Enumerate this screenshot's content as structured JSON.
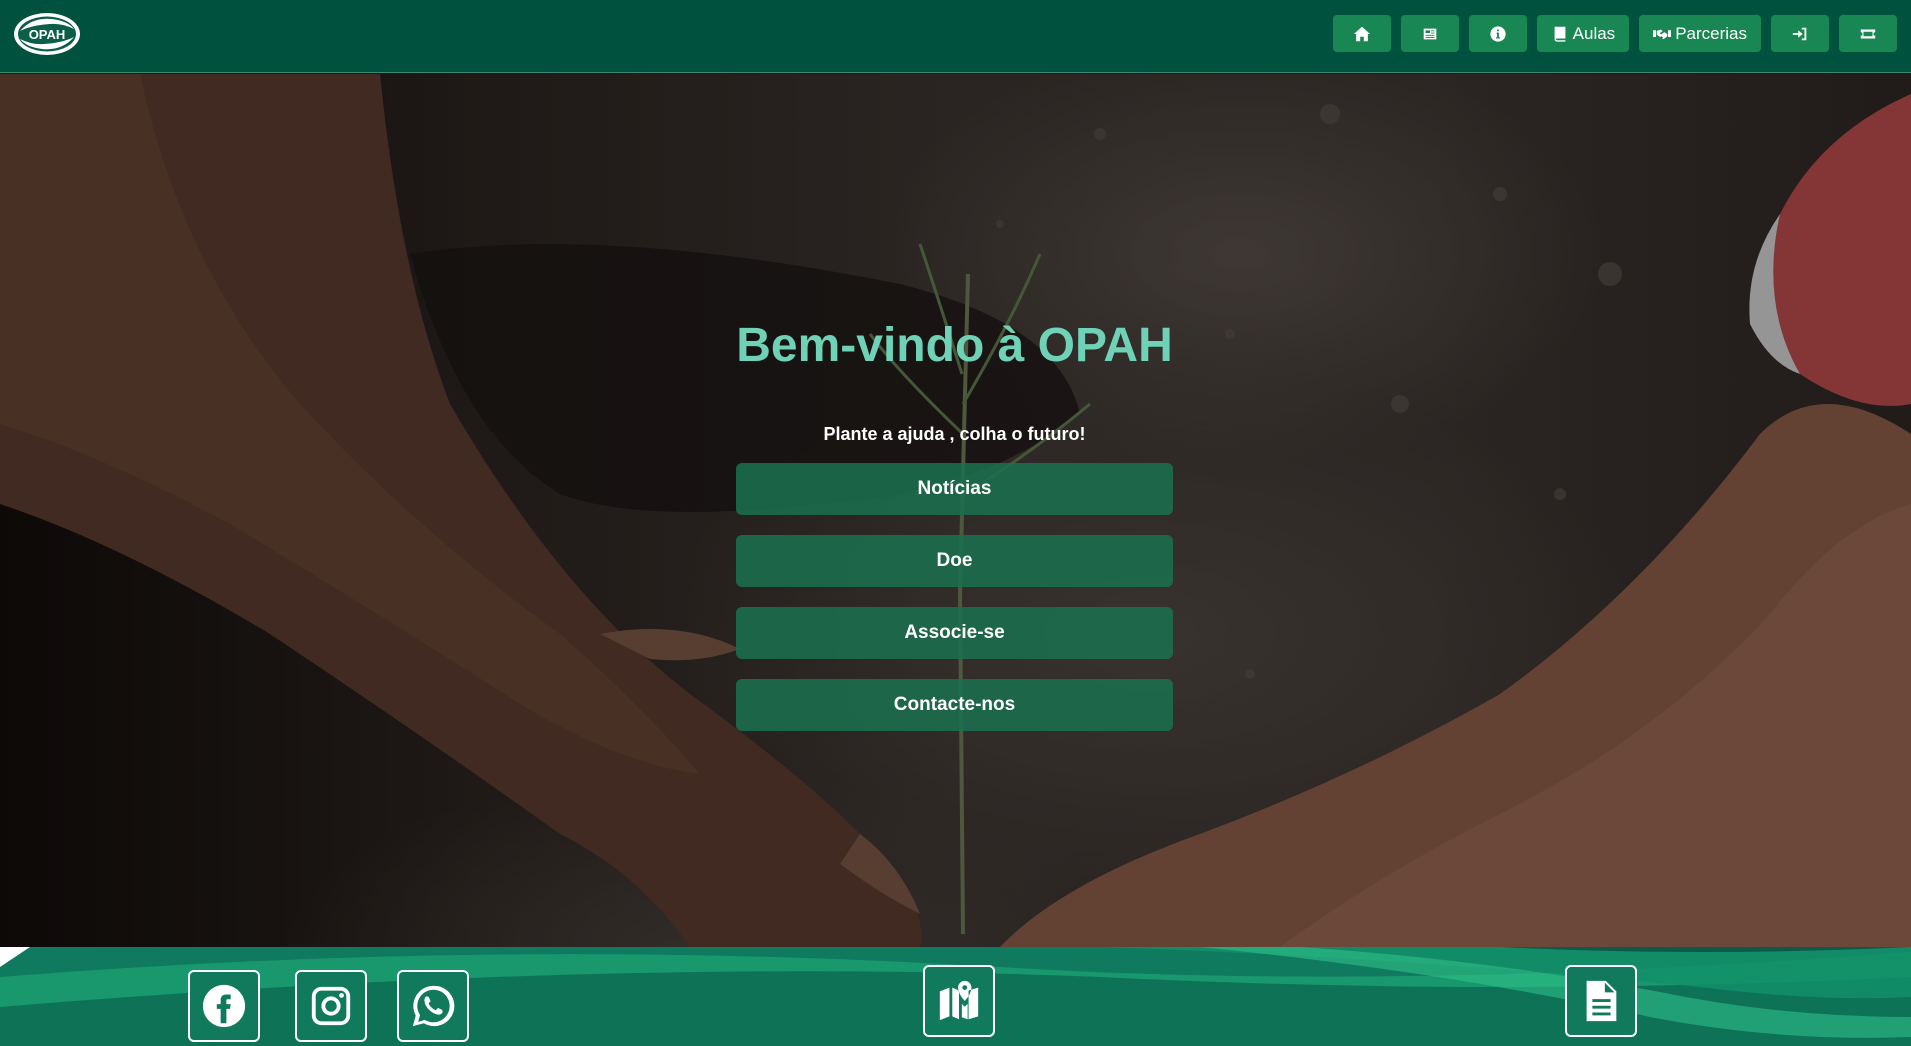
{
  "navbar": {
    "logo_text": "OPAH",
    "buttons": [
      {
        "icon": "home-icon",
        "label": ""
      },
      {
        "icon": "newspaper-icon",
        "label": ""
      },
      {
        "icon": "info-icon",
        "label": ""
      },
      {
        "icon": "book-icon",
        "label": "Aulas"
      },
      {
        "icon": "handshake-icon",
        "label": "Parcerias"
      },
      {
        "icon": "sign-in-icon",
        "label": ""
      },
      {
        "icon": "ticket-icon",
        "label": ""
      }
    ]
  },
  "hero": {
    "title": "Bem-vindo à OPAH",
    "subtitle": "Plante a ajuda , colha o futuro!",
    "buttons": [
      "Notícias",
      "Doe",
      "Associe-se",
      "Contacte-nos"
    ]
  },
  "footer": {
    "icons": [
      "facebook-icon",
      "instagram-icon",
      "whatsapp-icon",
      "map-icon",
      "document-icon"
    ]
  },
  "colors": {
    "navbar": "#00513d",
    "nav_button": "#198754",
    "title": "#6fd2b6",
    "hero_button": "#1b6e4e"
  }
}
